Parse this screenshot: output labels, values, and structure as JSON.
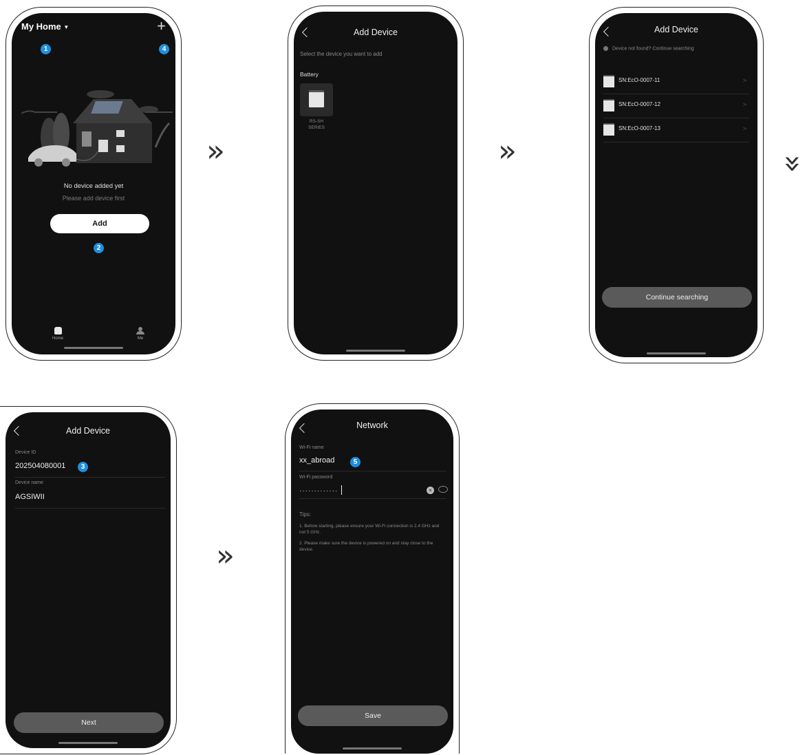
{
  "step_arrows": [
    "»",
    "»",
    "»",
    "»"
  ],
  "screen1": {
    "home_title": "My Home",
    "plus_glyph": "+",
    "badges": [
      "1",
      "4",
      "2"
    ],
    "empty_title": "No device added yet",
    "empty_subtitle": "Please add device first",
    "add_button": "Add",
    "nav": [
      {
        "label": "Home",
        "icon": "home-icon"
      },
      {
        "label": "Me",
        "icon": "person-icon"
      }
    ]
  },
  "screen2": {
    "title": "Add Device",
    "instruction": "Select the device you want to add",
    "category": "Battery",
    "device_label_line1": "RS-SH",
    "device_label_line2": "SERIES"
  },
  "screen3": {
    "title": "Add Device",
    "notice": "Device not found? Continue searching",
    "devices": [
      "SN:EcO-0007-11",
      "SN:EcO-0007-12",
      "SN:EcO-0007-13"
    ],
    "continue_button": "Continue searching"
  },
  "screen4": {
    "title": "Add Device",
    "device_id_label": "Device ID",
    "device_id_value": "202504080001",
    "badge": "3",
    "device_name_label": "Device name",
    "device_name_value": "AGSIWII",
    "next_button": "Next"
  },
  "screen5": {
    "title": "Network",
    "wifi_name_label": "Wi-Fi name",
    "wifi_name_value": "xx_abroad",
    "badge": "5",
    "wifi_password_label": "Wi-Fi password",
    "wifi_password_value": "·············",
    "tips_label": "Tips:",
    "tip1": "1. Before starting, please ensure your Wi-Fi connection is 2.4 GHz and not 5 GHz.",
    "tip2": "2. Please make sure the device is powered on and stay close to the device.",
    "save_button": "Save"
  },
  "colors": {
    "screen_bg": "#111111",
    "badge": "#1f8fe0",
    "button_grey": "#5a5a5a",
    "button_white": "#ffffff"
  }
}
